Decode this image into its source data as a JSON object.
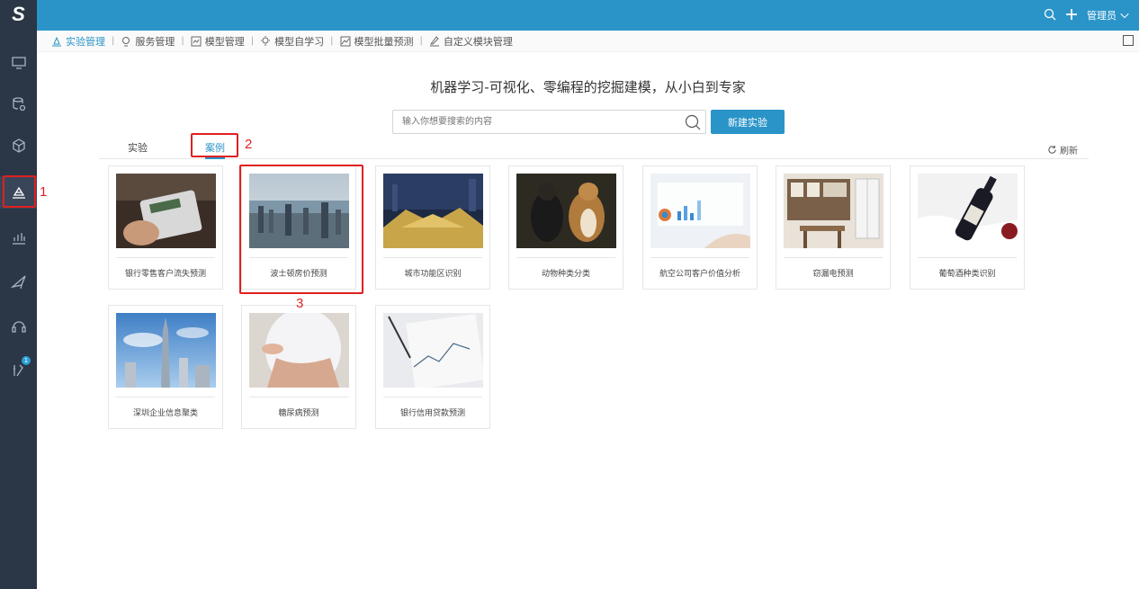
{
  "app": {
    "logo": "S"
  },
  "topbar": {
    "user": "管理员"
  },
  "breadcrumb": [
    {
      "label": "实验管理",
      "icon": "flask-icon"
    },
    {
      "label": "服务管理",
      "icon": "service-icon"
    },
    {
      "label": "模型管理",
      "icon": "model-icon"
    },
    {
      "label": "模型自学习",
      "icon": "bulb-icon"
    },
    {
      "label": "模型批量预测",
      "icon": "batch-chart-icon"
    },
    {
      "label": "自定义模块管理",
      "icon": "custom-module-icon"
    }
  ],
  "main": {
    "headline": "机器学习-可视化、零编程的挖掘建模，从小白到专家",
    "search_placeholder": "输入你想要搜索的内容",
    "new_button": "新建实验",
    "tabs": [
      "实验",
      "案例"
    ],
    "refresh": "刷新"
  },
  "cards": [
    "银行零售客户流失预测",
    "波士顿房价预测",
    "城市功能区识别",
    "动物种类分类",
    "航空公司客户价值分析",
    "窃漏电预测",
    "葡萄酒种类识别",
    "深圳企业信息聚类",
    "糖尿病预测",
    "银行信用贷款预测"
  ],
  "sidebar": {
    "badge": "1"
  },
  "annotations": [
    "1",
    "2",
    "3"
  ],
  "colors": {
    "accent": "#2a94c8",
    "sidebar": "#2b3646",
    "annotation": "#e02020"
  }
}
